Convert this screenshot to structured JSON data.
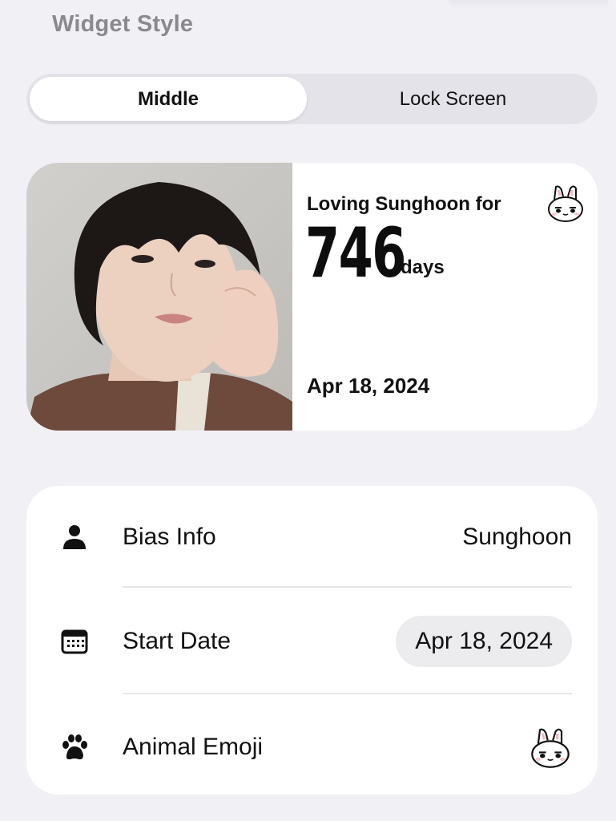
{
  "section_title": "Widget Style",
  "segmented": {
    "options": [
      "Middle",
      "Lock Screen"
    ],
    "selected": "Middle"
  },
  "widget": {
    "heading": "Loving Sunghoon for",
    "count": "746",
    "unit": "days",
    "date": "Apr 18, 2024",
    "photo_icon": "person-photo",
    "emoji_icon": "bunny-emoji-icon"
  },
  "settings": {
    "rows": [
      {
        "icon": "person-icon",
        "label": "Bias Info",
        "value": "Sunghoon"
      },
      {
        "icon": "calendar-icon",
        "label": "Start Date",
        "value": "Apr 18, 2024"
      },
      {
        "icon": "paw-icon",
        "label": "Animal Emoji",
        "value_icon": "bunny-emoji-icon"
      }
    ]
  },
  "colors": {
    "background": "#f1f0f5",
    "card": "#ffffff",
    "section_title": "#8a8a8e",
    "segment_track": "#e4e3e9",
    "pill": "#ececef"
  }
}
